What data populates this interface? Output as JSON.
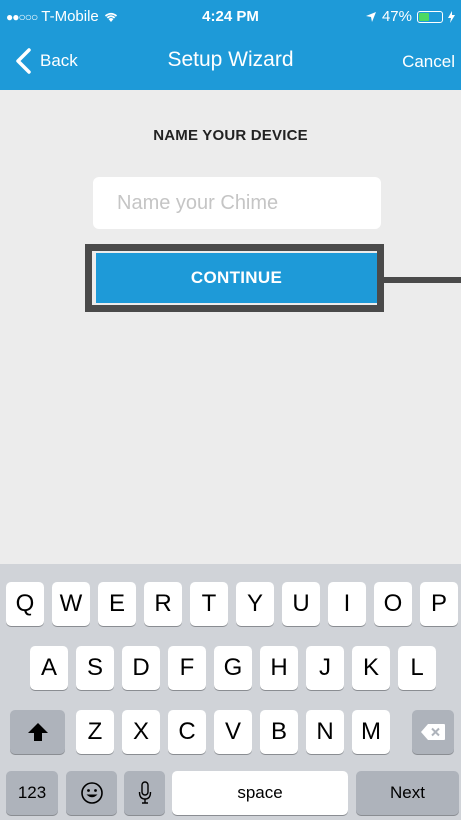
{
  "status_bar": {
    "signal": "●●○○○",
    "carrier": "T-Mobile",
    "time": "4:24 PM",
    "battery": "47%",
    "battery_level": 0.47
  },
  "nav": {
    "back_label": "Back",
    "title": "Setup Wizard",
    "cancel_label": "Cancel"
  },
  "form": {
    "heading": "NAME YOUR DEVICE",
    "name_placeholder": "Name your Chime",
    "name_value": "",
    "continue_label": "CONTINUE"
  },
  "keyboard": {
    "row1": [
      "Q",
      "W",
      "E",
      "R",
      "T",
      "Y",
      "U",
      "I",
      "O",
      "P"
    ],
    "row2": [
      "A",
      "S",
      "D",
      "F",
      "G",
      "H",
      "J",
      "K",
      "L"
    ],
    "row3": [
      "Z",
      "X",
      "C",
      "V",
      "B",
      "N",
      "M"
    ],
    "numbers_label": "123",
    "space_label": "space",
    "next_label": "Next"
  },
  "colors": {
    "accent": "#1e9ad8",
    "frame": "#4a4a4a",
    "background": "#ececec"
  }
}
